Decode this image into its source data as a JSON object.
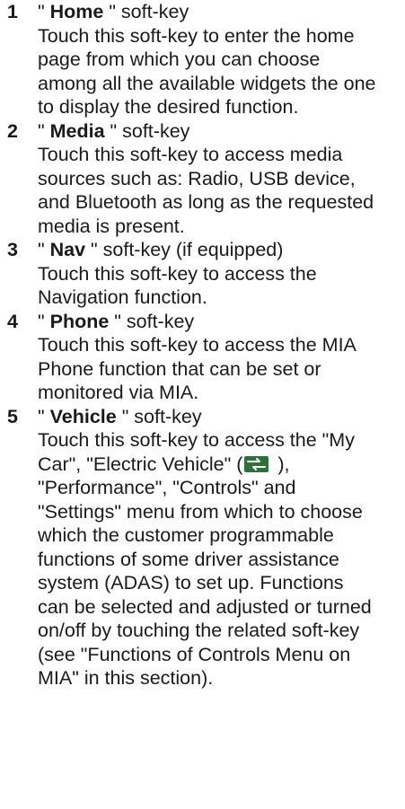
{
  "items": [
    {
      "number": "1",
      "quote_open": "\" ",
      "key": "Home",
      "quote_close": " \" soft-key",
      "desc": "Touch this soft-key to enter the home page from which you can choose among all the available widgets the one to display the desired function."
    },
    {
      "number": "2",
      "quote_open": "\" ",
      "key": "Media",
      "quote_close": " \" soft-key",
      "desc": "Touch this soft-key to access media sources such as: Radio, USB device, and Bluetooth as long as the requested media is present."
    },
    {
      "number": "3",
      "quote_open": "\" ",
      "key": "Nav",
      "quote_close": " \" soft-key (if equipped)",
      "desc": "Touch this soft-key to access the Navigation function."
    },
    {
      "number": "4",
      "quote_open": "\" ",
      "key": "Phone",
      "quote_close": " \" soft-key",
      "desc": "Touch this soft-key to access the MIA Phone function that can be set or monitored via MIA."
    },
    {
      "number": "5",
      "quote_open": "\" ",
      "key": "Vehicle",
      "quote_close": " \" soft-key",
      "desc_before_icon": "Touch this soft-key to access the \"My Car\", \"Electric Vehicle\" (",
      "desc_after_icon": " ), \"Performance\", \"Controls\" and \"Settings\" menu from which to choose which the customer programmable functions of some driver assistance system (ADAS) to set up. Functions can be selected and adjusted or turned on/off by touching the related soft-key (see \"Functions of Controls Menu on MIA\" in this section)."
    }
  ],
  "icons": {
    "ev_icon": "electric-vehicle-icon",
    "ev_icon_color": "#2f6f3a"
  }
}
